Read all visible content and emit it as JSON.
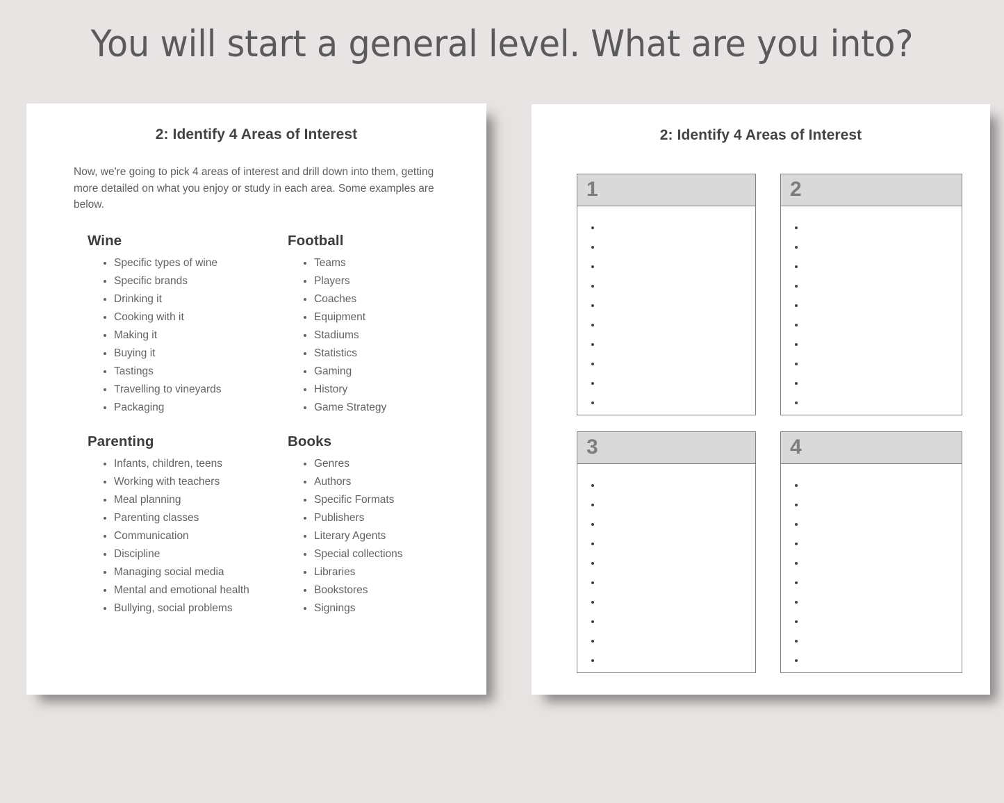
{
  "slide": {
    "title": "You will start a general level. What are you into?",
    "background_color": "#e8e4e3",
    "title_color": "#5a5a5a"
  },
  "left_card": {
    "title": "2: Identify 4 Areas of Interest",
    "intro": "Now, we're going to pick 4 areas of interest and drill down into them, getting more detailed on what you enjoy or study in each area.  Some examples are below.",
    "columns": [
      {
        "heading": "Wine",
        "items": [
          "Specific types of wine",
          "Specific brands",
          "Drinking it",
          "Cooking with it",
          "Making it",
          "Buying it",
          "Tastings",
          "Travelling to vineyards",
          "Packaging"
        ]
      },
      {
        "heading": "Football",
        "items": [
          "Teams",
          "Players",
          "Coaches",
          "Equipment",
          "Stadiums",
          "Statistics",
          "Gaming",
          "History",
          "Game Strategy"
        ]
      },
      {
        "heading": "Parenting",
        "items": [
          "Infants, children, teens",
          "Working with teachers",
          "Meal planning",
          "Parenting classes",
          "Communication",
          "Discipline",
          "Managing social media",
          "Mental and emotional health",
          "Bullying, social problems"
        ]
      },
      {
        "heading": "Books",
        "items": [
          "Genres",
          "Authors",
          "Specific Formats",
          "Publishers",
          "Literary Agents",
          "Special collections",
          "Libraries",
          "Bookstores",
          "Signings"
        ]
      }
    ]
  },
  "right_card": {
    "title": "2: Identify 4 Areas of Interest",
    "header_color": "#d9d9d9",
    "border_color": "#808080",
    "boxes": [
      {
        "number": "1",
        "bullet_count": 10,
        "entries": [
          "",
          "",
          "",
          "",
          "",
          "",
          "",
          "",
          "",
          ""
        ]
      },
      {
        "number": "2",
        "bullet_count": 10,
        "entries": [
          "",
          "",
          "",
          "",
          "",
          "",
          "",
          "",
          "",
          ""
        ]
      },
      {
        "number": "3",
        "bullet_count": 10,
        "entries": [
          "",
          "",
          "",
          "",
          "",
          "",
          "",
          "",
          "",
          ""
        ]
      },
      {
        "number": "4",
        "bullet_count": 10,
        "entries": [
          "",
          "",
          "",
          "",
          "",
          "",
          "",
          "",
          "",
          ""
        ]
      }
    ]
  }
}
